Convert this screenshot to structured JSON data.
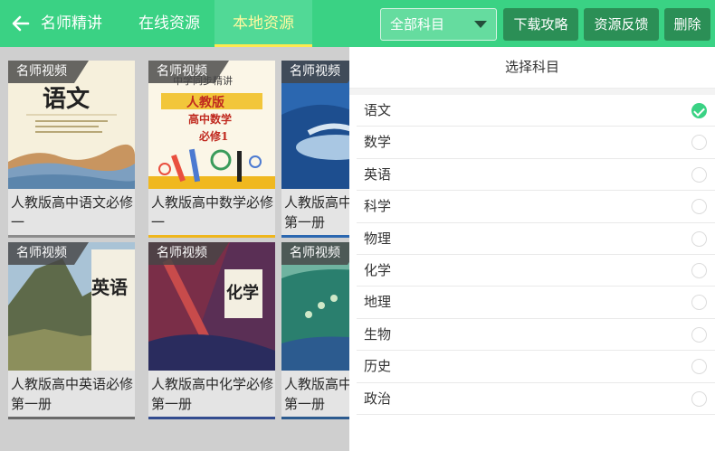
{
  "header": {
    "back_icon": "arrow-left-icon",
    "title": "名师精讲",
    "tabs": [
      {
        "label": "在线资源",
        "active": false
      },
      {
        "label": "本地资源",
        "active": true
      }
    ],
    "subject_select": {
      "value": "全部科目",
      "icon": "caret-down-icon"
    },
    "buttons": {
      "guide": "下载攻略",
      "feedback": "资源反馈",
      "delete": "删除"
    }
  },
  "books": [
    {
      "badge": "名师视频",
      "title": "人教版高中语文必修一",
      "cover_text": "语文"
    },
    {
      "badge": "名师视频",
      "title": "人教版高中数学必修一",
      "cover_lines": [
        "中学同步精讲",
        "人教版",
        "高中数学",
        "必修1"
      ]
    },
    {
      "badge": "名师视频",
      "title": "人教版高中物理必修第一册"
    },
    {
      "badge": "名师视频",
      "title": "人教版高中英语必修第一册",
      "cover_text": "英语"
    },
    {
      "badge": "名师视频",
      "title": "人教版高中化学必修第一册",
      "cover_text": "化学"
    },
    {
      "badge": "名师视频",
      "title": "人教版高中生物必修第一册"
    }
  ],
  "drawer": {
    "title": "选择科目",
    "subjects": [
      {
        "name": "语文",
        "selected": true
      },
      {
        "name": "数学",
        "selected": false
      },
      {
        "name": "英语",
        "selected": false
      },
      {
        "name": "科学",
        "selected": false
      },
      {
        "name": "物理",
        "selected": false
      },
      {
        "name": "化学",
        "selected": false
      },
      {
        "name": "地理",
        "selected": false
      },
      {
        "name": "生物",
        "selected": false
      },
      {
        "name": "历史",
        "selected": false
      },
      {
        "name": "政治",
        "selected": false
      }
    ]
  },
  "colors": {
    "accent": "#3ad284",
    "button_dark": "#2b8f56",
    "tab_active_text": "#fff9a0",
    "tab_underline": "#ffe94f"
  }
}
